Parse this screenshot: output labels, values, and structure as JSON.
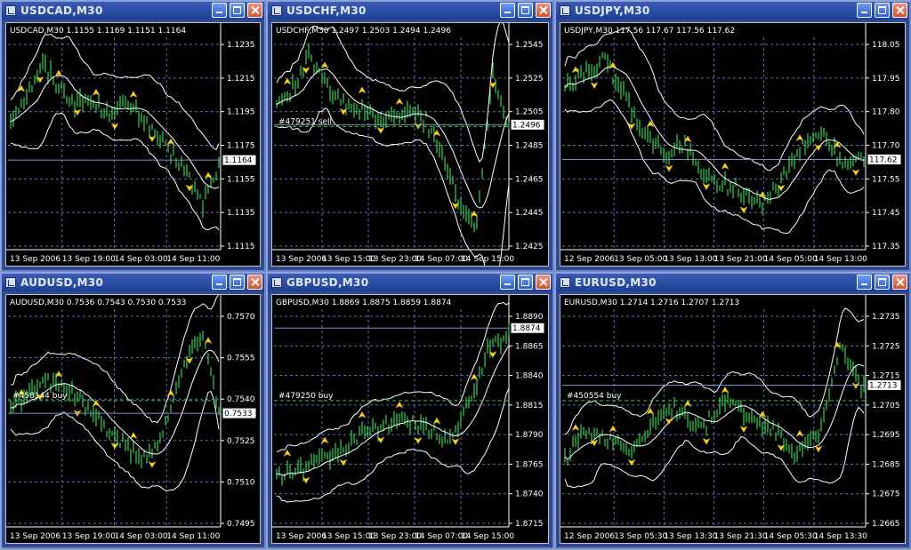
{
  "windows": [
    {
      "title": "USDCAD,M30",
      "ohlc_label": "USDCAD,M30  1.1155 1.1169 1.1151 1.1164",
      "price_levels": [
        "1.1235",
        "1.1215",
        "1.1195",
        "1.1175",
        "1.1155",
        "1.1135",
        "1.1115"
      ],
      "current_price": "1.1164",
      "time_labels": [
        "13 Sep 2006",
        "13 Sep 19:00",
        "14 Sep 03:00",
        "14 Sep 11:00"
      ],
      "order_label": ""
    },
    {
      "title": "USDCHF,M30",
      "ohlc_label": "USDCHF,M30  1.2497 1.2503 1.2494 1.2496",
      "price_levels": [
        "1.2545",
        "1.2525",
        "1.2505",
        "1.2485",
        "1.2465",
        "1.2445",
        "1.2425"
      ],
      "current_price": "1.2496",
      "time_labels": [
        "13 Sep 2006",
        "13 Sep 15:00",
        "13 Sep 23:00",
        "14 Sep 07:00",
        "14 Sep 15:00"
      ],
      "order_label": "#479251 sell"
    },
    {
      "title": "USDJPY,M30",
      "ohlc_label": "USDJPY,M30  117.56 117.67 117.56 117.62",
      "price_levels": [
        "118.05",
        "117.95",
        "117.80",
        "117.70",
        "117.55",
        "117.45",
        "117.35"
      ],
      "current_price": "117.62",
      "time_labels": [
        "12 Sep 2006",
        "13 Sep 05:00",
        "13 Sep 13:00",
        "13 Sep 21:00",
        "14 Sep 05:00",
        "14 Sep 13:00"
      ],
      "order_label": ""
    },
    {
      "title": "AUDUSD,M30",
      "ohlc_label": "AUDUSD,M30  0.7536 0.7543 0.7530 0.7533",
      "price_levels": [
        "0.7570",
        "0.7555",
        "0.7540",
        "0.7525",
        "0.7510",
        "0.7495"
      ],
      "current_price": "0.7533",
      "time_labels": [
        "13 Sep 2006",
        "13 Sep 19:00",
        "14 Sep 03:00",
        "14 Sep 11:00"
      ],
      "order_label": "#458144 buy"
    },
    {
      "title": "GBPUSD,M30",
      "ohlc_label": "GBPUSD,M30  1.8869 1.8875 1.8859 1.8874",
      "price_levels": [
        "1.8890",
        "1.8865",
        "1.8840",
        "1.8815",
        "1.8790",
        "1.8765",
        "1.8740",
        "1.8715"
      ],
      "current_price": "1.8874",
      "time_labels": [
        "13 Sep 2006",
        "13 Sep 15:00",
        "13 Sep 23:00",
        "14 Sep 07:00",
        "14 Sep 15:00"
      ],
      "order_label": "#479250 buy"
    },
    {
      "title": "EURUSD,M30",
      "ohlc_label": "EURUSD,M30  1.2714 1.2716 1.2707 1.2713",
      "price_levels": [
        "1.2735",
        "1.2725",
        "1.2715",
        "1.2705",
        "1.2695",
        "1.2685",
        "1.2675",
        "1.2665"
      ],
      "current_price": "1.2713",
      "time_labels": [
        "12 Sep 2006",
        "13 Sep 05:30",
        "13 Sep 13:30",
        "13 Sep 21:30",
        "14 Sep 05:30",
        "14 Sep 13:30"
      ],
      "order_label": "#450554 buy"
    }
  ],
  "colors": {
    "candles": "#33ff66",
    "bands": "#ffffff",
    "fractal_arrows": "#ffd700",
    "grid": "#5a6fb4",
    "title_bar": "#2a55b8",
    "close_button": "#d9512e"
  },
  "icons": {
    "window_icon": "chart-window-icon",
    "minimize": "minimize-icon",
    "maximize": "maximize-icon",
    "close": "close-icon",
    "fractal": "fractal-arrow-icon"
  }
}
